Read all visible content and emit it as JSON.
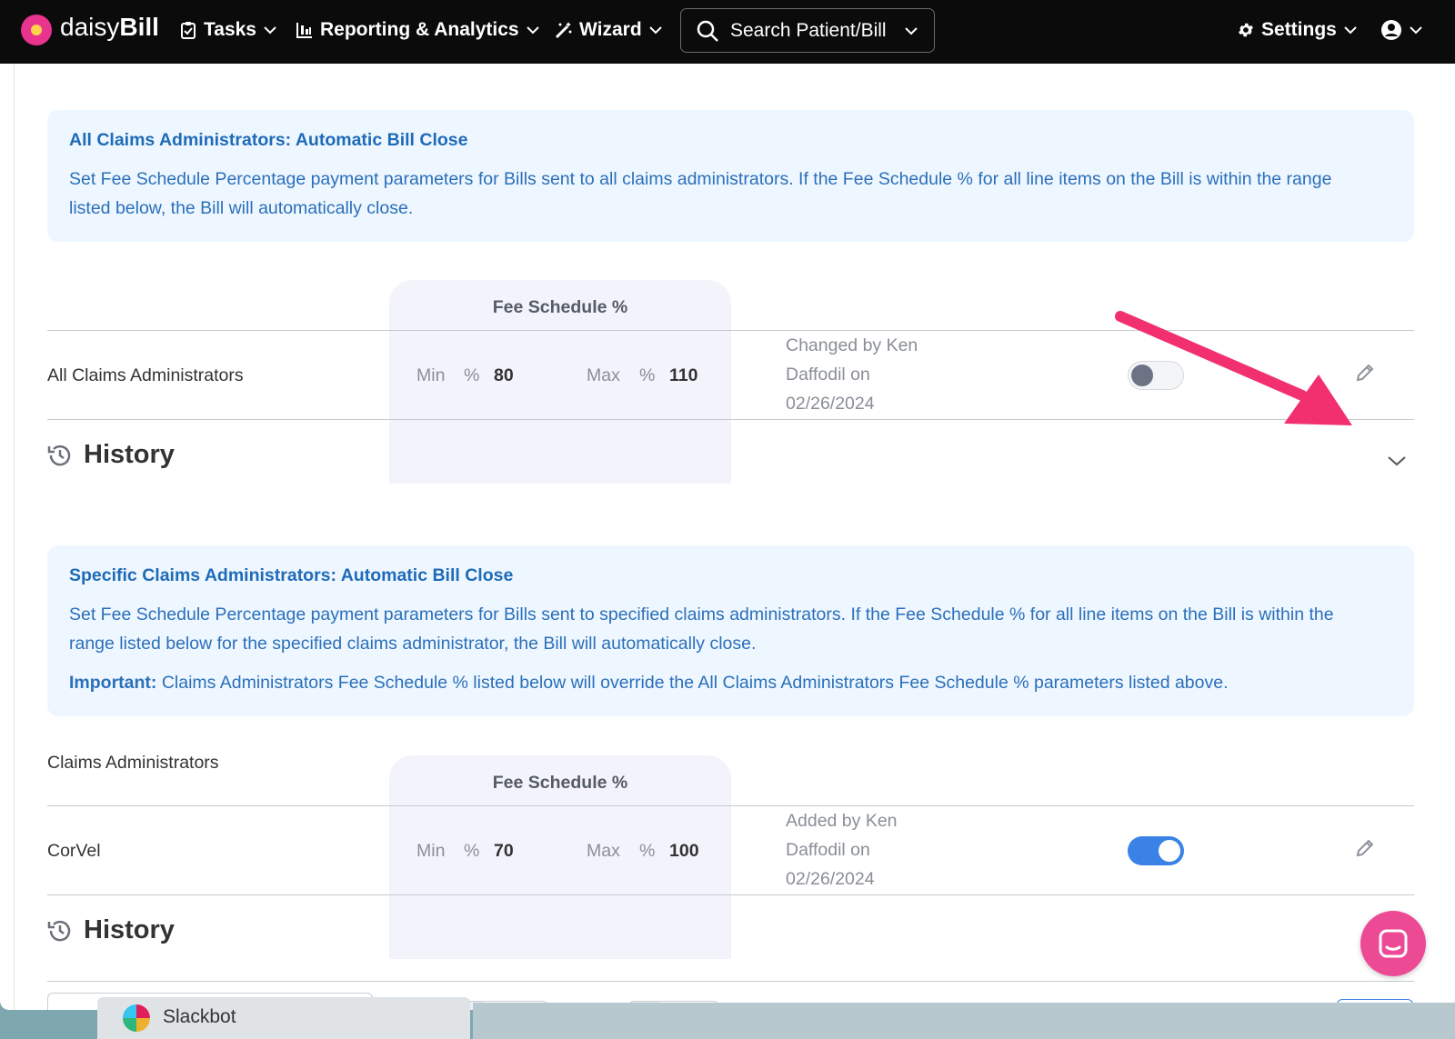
{
  "nav": {
    "brand_light": "daisy",
    "brand_bold": "Bill",
    "tasks": "Tasks",
    "reporting": "Reporting & Analytics",
    "wizard": "Wizard",
    "search_placeholder": "Search Patient/Bill",
    "settings": "Settings"
  },
  "all_section": {
    "title": "All Claims Administrators: Automatic Bill Close",
    "description": "Set Fee Schedule Percentage payment parameters for Bills sent to all claims administrators. If the Fee Schedule % for all line items on the Bill is within the range listed below, the Bill will automatically close.",
    "fee_header": "Fee Schedule %",
    "row": {
      "name": "All Claims Administrators",
      "min_label": "Min",
      "max_label": "Max",
      "pct": "%",
      "min": "80",
      "max": "110",
      "changed_line1": "Changed by Ken",
      "changed_line2": "Daffodil on",
      "changed_line3": "02/26/2024",
      "enabled": false
    },
    "history": "History"
  },
  "specific_section": {
    "title": "Specific Claims Administrators: Automatic Bill Close",
    "description": "Set Fee Schedule Percentage payment parameters for Bills sent to specified claims administrators. If the Fee Schedule % for all line items on the Bill is within the range listed below for the specified claims administrator, the Bill will automatically close.",
    "important_label": "Important:",
    "important_text": " Claims Administrators Fee Schedule % listed below will override the All Claims Administrators Fee Schedule % parameters listed above.",
    "col_claims": "Claims Administrators",
    "fee_header": "Fee Schedule %",
    "row": {
      "name": "CorVel",
      "min_label": "Min",
      "max_label": "Max",
      "pct": "%",
      "min": "70",
      "max": "100",
      "added_line1": "Added by Ken",
      "added_line2": "Daffodil on",
      "added_line3": "02/26/2024",
      "enabled": true
    },
    "history": "History"
  },
  "dock": {
    "app": "Slackbot"
  },
  "colors": {
    "accent": "#1f6bb8",
    "toggle_on": "#3b82e6",
    "arrow": "#f2306f",
    "chat": "#ed4a96"
  }
}
